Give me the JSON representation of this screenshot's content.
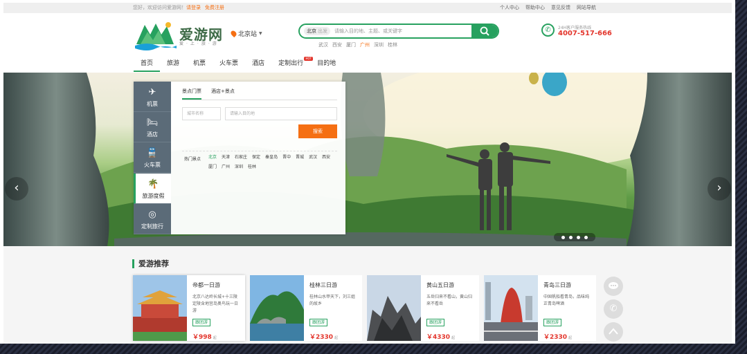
{
  "topbar": {
    "welcome": "您好，欢迎访问爱游网！",
    "login": "请登录",
    "register": "免费注册",
    "links": [
      "个人中心",
      "帮助中心",
      "意见反馈",
      "网站导航"
    ]
  },
  "logo": {
    "text": "爱游网",
    "sub": "爱·上·旅·游"
  },
  "city": {
    "label": "北京站"
  },
  "search": {
    "scope": "北京",
    "scope_hint": "出发",
    "placeholder": "请输入目的地、主题、或关键字",
    "icon": "search-icon",
    "hot_cities": [
      {
        "name": "武汉",
        "active": false
      },
      {
        "name": "西安",
        "active": false
      },
      {
        "name": "厦门",
        "active": false
      },
      {
        "name": "广州",
        "active": true
      },
      {
        "name": "深圳",
        "active": false
      },
      {
        "name": "桂林",
        "active": false
      }
    ]
  },
  "hotline": {
    "label": "24H客户服务热线",
    "number": "4007-517-666",
    "icon": "phone-icon"
  },
  "nav": [
    {
      "label": "首页",
      "active": true,
      "hot": false
    },
    {
      "label": "旅游",
      "active": false,
      "hot": false
    },
    {
      "label": "机票",
      "active": false,
      "hot": false
    },
    {
      "label": "火车票",
      "active": false,
      "hot": false
    },
    {
      "label": "酒店",
      "active": false,
      "hot": false
    },
    {
      "label": "定制出行",
      "active": false,
      "hot": true,
      "hot_text": "HOT"
    },
    {
      "label": "目的地",
      "active": false,
      "hot": false
    }
  ],
  "banner": {
    "prev": "‹",
    "next": "›",
    "slides": 4
  },
  "widget": {
    "categories": [
      {
        "label": "机票",
        "icon": "plane-icon",
        "active": false
      },
      {
        "label": "酒店",
        "icon": "bed-icon",
        "active": false
      },
      {
        "label": "火车票",
        "icon": "train-icon",
        "active": false
      },
      {
        "label": "旅游度假",
        "icon": "palm-tree-icon",
        "active": true
      },
      {
        "label": "定制旅行",
        "icon": "compass-icon",
        "active": false
      }
    ],
    "tabs": [
      {
        "label": "景点门票",
        "active": true
      },
      {
        "label": "酒店+景点",
        "active": false
      }
    ],
    "city_placeholder": "城市名称",
    "dest_placeholder": "请输入目的地",
    "search_label": "搜索",
    "hot_label": "热门景点",
    "hot_list": [
      {
        "name": "北京",
        "active": true
      },
      {
        "name": "天津",
        "active": false
      },
      {
        "name": "石家庄",
        "active": false
      },
      {
        "name": "保定",
        "active": false
      },
      {
        "name": "秦皇岛",
        "active": false
      },
      {
        "name": "晋中",
        "active": false
      },
      {
        "name": "晋城",
        "active": false
      },
      {
        "name": "武汉",
        "active": false
      },
      {
        "name": "西安",
        "active": false
      },
      {
        "name": "厦门",
        "active": false
      },
      {
        "name": "广州",
        "active": false
      },
      {
        "name": "深圳",
        "active": false
      },
      {
        "name": "桂林",
        "active": false
      }
    ]
  },
  "recommend": {
    "title": "爱游推荐",
    "cards": [
      {
        "title": "帝都一日游",
        "desc": "北京八达岭长城+十三陵定陵含地宫岛奥鸟玩一日游",
        "tag": "跟团游",
        "price": "￥998",
        "unit": "起",
        "image": "tiananmen"
      },
      {
        "title": "桂林三日游",
        "desc": "桂林山水甲天下，刘三姐的故乡",
        "tag": "跟团游",
        "price": "￥2330",
        "unit": "起",
        "image": "guilin"
      },
      {
        "title": "黄山五日游",
        "desc": "五岳归来不看山，黄山归来不看岳",
        "tag": "跟团游",
        "price": "￥4330",
        "unit": "起",
        "image": "huangshan"
      },
      {
        "title": "青岛三日游",
        "desc": "中国帆船看青岛，品味纯正青岛啤酒",
        "tag": "跟团游",
        "price": "￥2330",
        "unit": "起",
        "image": "qingdao"
      }
    ]
  },
  "side_tools": [
    {
      "icon": "chat-icon"
    },
    {
      "icon": "phone-icon"
    },
    {
      "icon": "back-to-top-icon"
    }
  ],
  "colors": {
    "brand": "#27a15f",
    "accent": "#f56f13",
    "price": "#e3352c",
    "sidebar": "#5b6b78"
  }
}
